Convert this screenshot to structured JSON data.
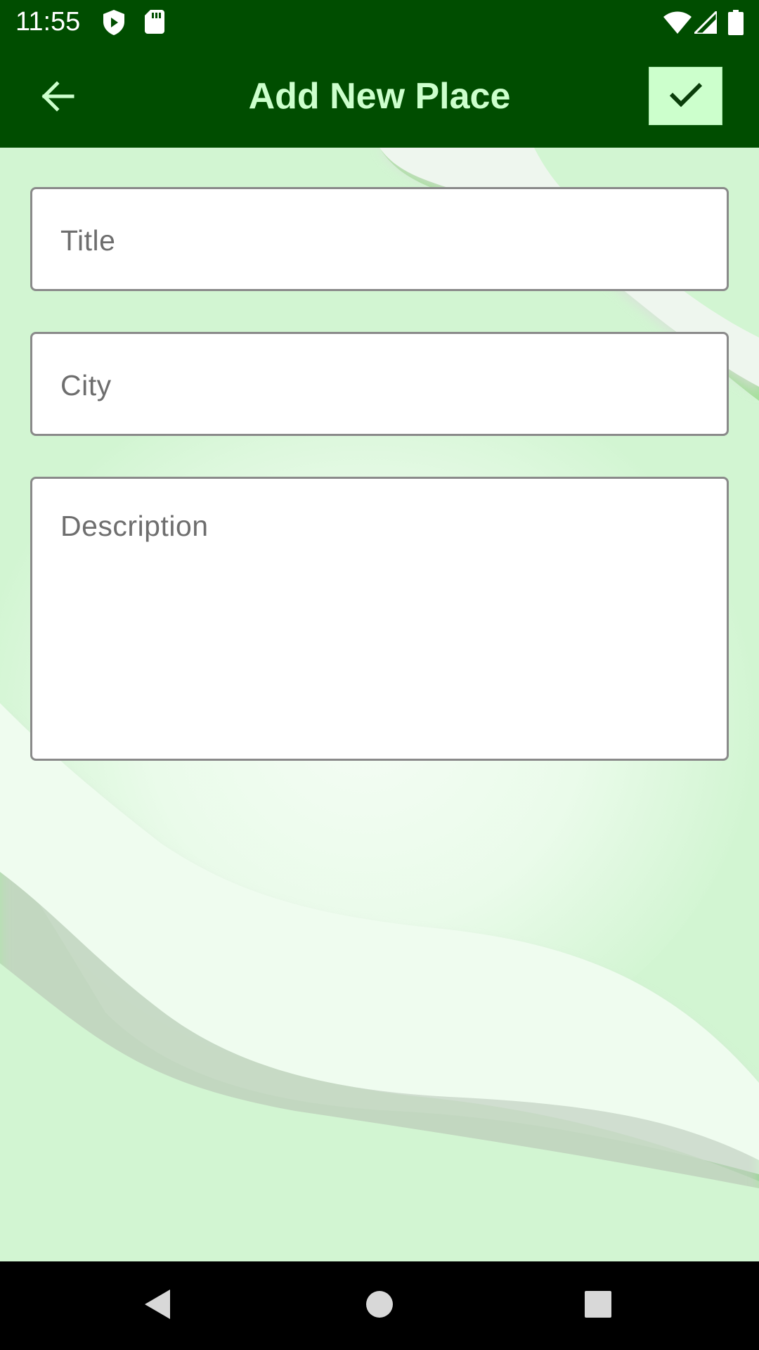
{
  "status_bar": {
    "time": "11:55",
    "left_icons": [
      "play-protect-icon",
      "sd-card-icon"
    ],
    "right_icons": [
      "wifi-icon",
      "cell-signal-icon",
      "battery-icon"
    ]
  },
  "app_bar": {
    "title": "Add New Place",
    "back_icon": "arrow-left-icon",
    "save_icon": "check-icon"
  },
  "form": {
    "title_placeholder": "Title",
    "city_placeholder": "City",
    "description_placeholder": "Description"
  },
  "nav_bar": {
    "icons": [
      "back-triangle-icon",
      "home-circle-icon",
      "recents-square-icon"
    ]
  },
  "colors": {
    "app_bar": "#004d00",
    "title_text": "#ccffcc",
    "save_button": "#ccffcc",
    "background": "#d2f5d2"
  }
}
